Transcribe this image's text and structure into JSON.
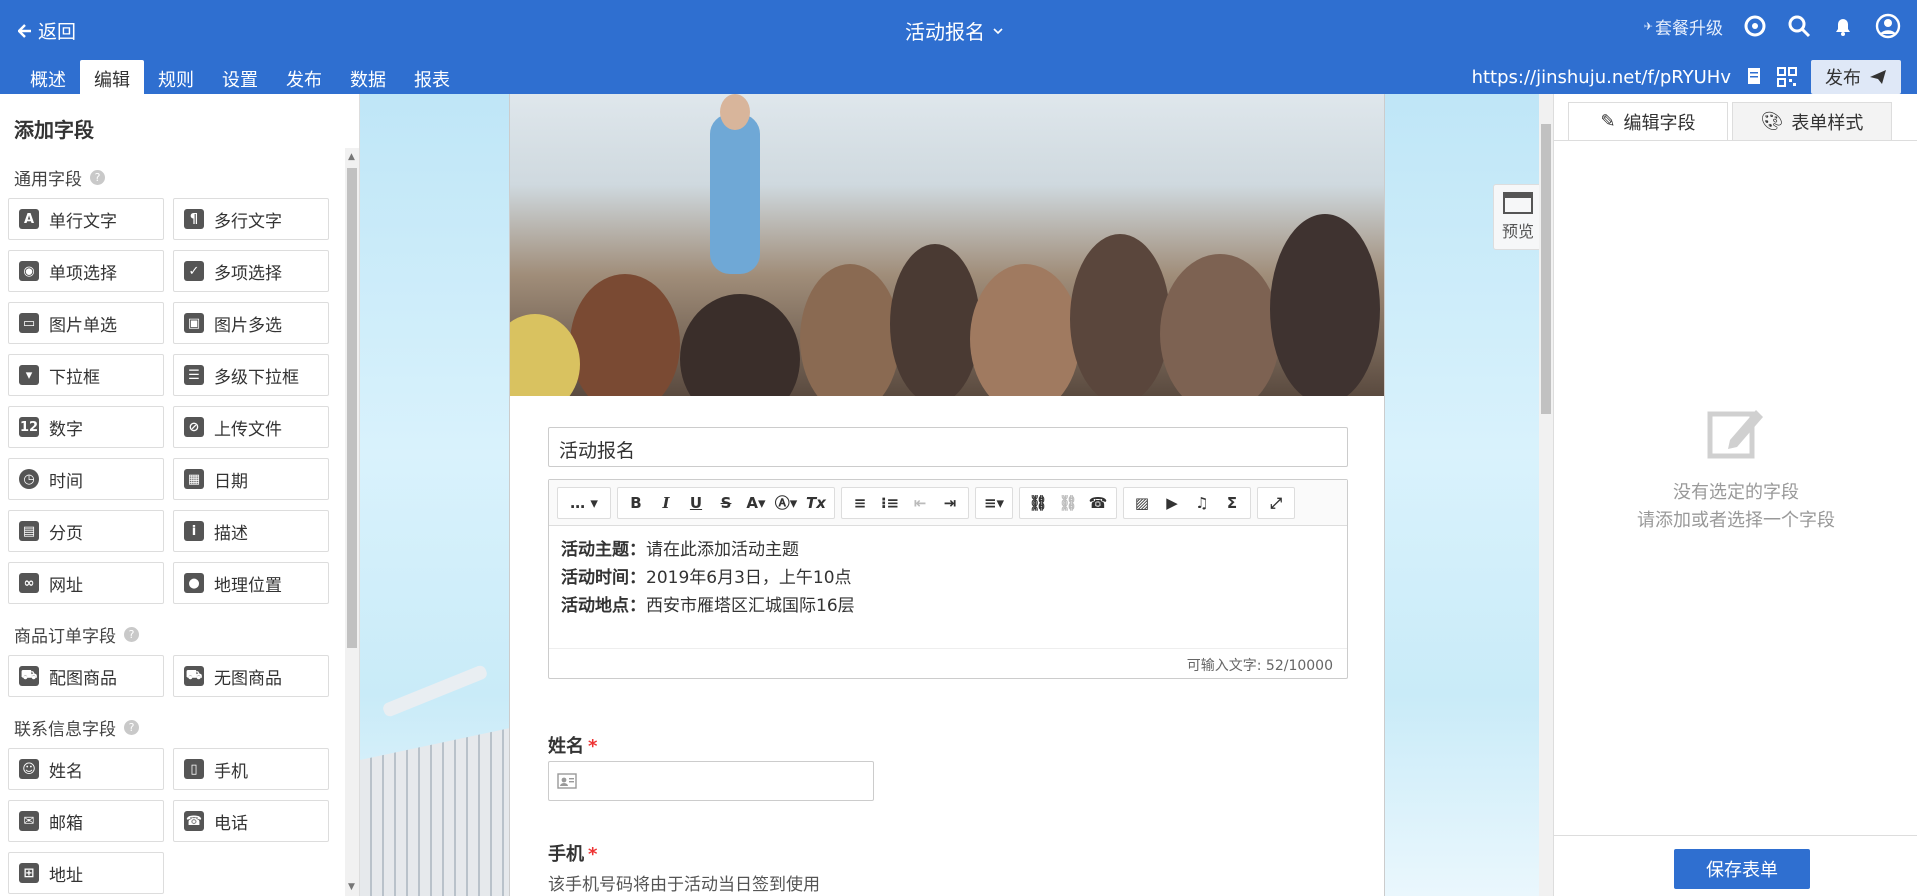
{
  "header": {
    "back_label": "返回",
    "form_title": "活动报名",
    "upgrade_label": "套餐升级"
  },
  "tabs": [
    "概述",
    "编辑",
    "规则",
    "设置",
    "发布",
    "数据",
    "报表"
  ],
  "active_tab": "编辑",
  "share": {
    "url": "https://jinshuju.net/f/pRYUHv",
    "publish_label": "发布"
  },
  "left": {
    "title": "添加字段",
    "sections": [
      {
        "title": "通用字段",
        "fields": [
          {
            "label": "单行文字",
            "icon": "text-a-icon"
          },
          {
            "label": "多行文字",
            "icon": "paragraph-icon"
          },
          {
            "label": "单项选择",
            "icon": "radio-icon"
          },
          {
            "label": "多项选择",
            "icon": "checkbox-icon"
          },
          {
            "label": "图片单选",
            "icon": "image-icon"
          },
          {
            "label": "图片多选",
            "icon": "images-icon"
          },
          {
            "label": "下拉框",
            "icon": "dropdown-icon"
          },
          {
            "label": "多级下拉框",
            "icon": "cascade-dropdown-icon"
          },
          {
            "label": "数字",
            "icon": "number-icon"
          },
          {
            "label": "上传文件",
            "icon": "paperclip-icon"
          },
          {
            "label": "时间",
            "icon": "clock-icon"
          },
          {
            "label": "日期",
            "icon": "calendar-icon"
          },
          {
            "label": "分页",
            "icon": "page-break-icon"
          },
          {
            "label": "描述",
            "icon": "info-icon"
          },
          {
            "label": "网址",
            "icon": "link-icon"
          },
          {
            "label": "地理位置",
            "icon": "location-pin-icon"
          }
        ]
      },
      {
        "title": "商品订单字段",
        "fields": [
          {
            "label": "配图商品",
            "icon": "cart-image-icon"
          },
          {
            "label": "无图商品",
            "icon": "cart-icon"
          }
        ]
      },
      {
        "title": "联系信息字段",
        "fields": [
          {
            "label": "姓名",
            "icon": "person-card-icon"
          },
          {
            "label": "手机",
            "icon": "mobile-icon"
          },
          {
            "label": "邮箱",
            "icon": "envelope-icon"
          },
          {
            "label": "电话",
            "icon": "phone-icon"
          },
          {
            "label": "地址",
            "icon": "address-icon"
          }
        ]
      }
    ]
  },
  "canvas": {
    "preview_label": "预览",
    "form_title_value": "活动报名",
    "description_lines": [
      {
        "key": "活动主题：",
        "value": "请在此添加活动主题"
      },
      {
        "key": "活动时间：",
        "value": "2019年6月3日，上午10点"
      },
      {
        "key": "活动地点：",
        "value": "西安市雁塔区汇城国际16层"
      }
    ],
    "char_counter": "可输入文字: 52/10000",
    "fields": [
      {
        "label": "姓名",
        "required": "*"
      },
      {
        "label": "手机",
        "required": "*",
        "help": "该手机号码将由于活动当日签到使用"
      }
    ]
  },
  "right": {
    "tab_edit_field": "编辑字段",
    "tab_form_style": "表单样式",
    "empty_line1": "没有选定的字段",
    "empty_line2": "请添加或者选择一个字段",
    "save_label": "保存表单"
  },
  "colors": {
    "brand": "#2f6fd0",
    "required": "#ee3333"
  }
}
